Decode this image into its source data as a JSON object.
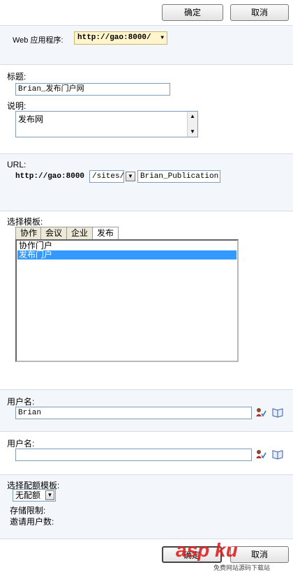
{
  "toolbar": {
    "ok_label": "确定",
    "cancel_label": "取消"
  },
  "webapp": {
    "label": "Web 应用程序:",
    "value": "http://gao:8000/"
  },
  "title_section": {
    "title_label": "标题:",
    "title_value": "Brian_发布门户网",
    "desc_label": "说明:",
    "desc_value": "发布网"
  },
  "url": {
    "label": "URL:",
    "host": "http://gao:8000",
    "path": "/sites/",
    "name": "Brian_Publication"
  },
  "template": {
    "label": "选择模板:",
    "tabs": [
      "协作",
      "会议",
      "企业",
      "发布"
    ],
    "active_tab": "发布",
    "items": [
      "协作门户",
      "发布门户"
    ],
    "selected": "发布门户"
  },
  "primary_admin": {
    "label": "用户名:",
    "value": "Brian"
  },
  "secondary_admin": {
    "label": "用户名:",
    "value": ""
  },
  "quota": {
    "label": "选择配额模板:",
    "value": "无配额",
    "storage_label": "存储限制:",
    "invite_label": "邀请用户数:"
  },
  "footer": {
    "ok_label": "确定",
    "cancel_label": "取消",
    "watermark": "asp ku",
    "watermark_sub": "免费网站源码下载站"
  },
  "colors": {
    "band": "#f3f6fb",
    "selection": "#3399ff",
    "webapp_bg": "#fff5cc"
  }
}
